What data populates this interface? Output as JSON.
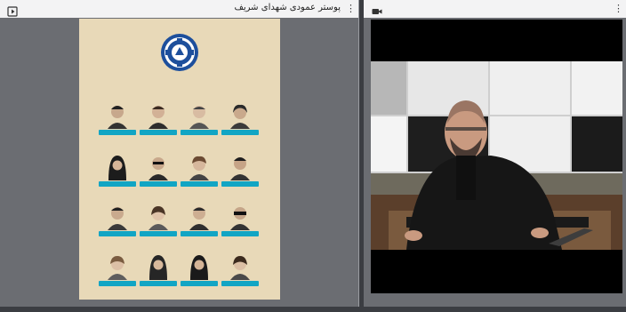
{
  "left_panel": {
    "title": "پوستر عمودی شهدای شریف",
    "header_icon": "presentation-play-icon",
    "menu_icon": "kebab-menu-icon",
    "poster": {
      "logo": "university-gear-logo",
      "accent_color": "#12a5c4",
      "background_color": "#e8d9b8"
    }
  },
  "right_panel": {
    "header_icon": "video-camera-icon",
    "menu_icon": "kebab-menu-icon"
  },
  "colors": {
    "panel_bg": "#f3f3f4",
    "app_bg": "#3b3d42",
    "stage_bg": "#6b6d72"
  }
}
